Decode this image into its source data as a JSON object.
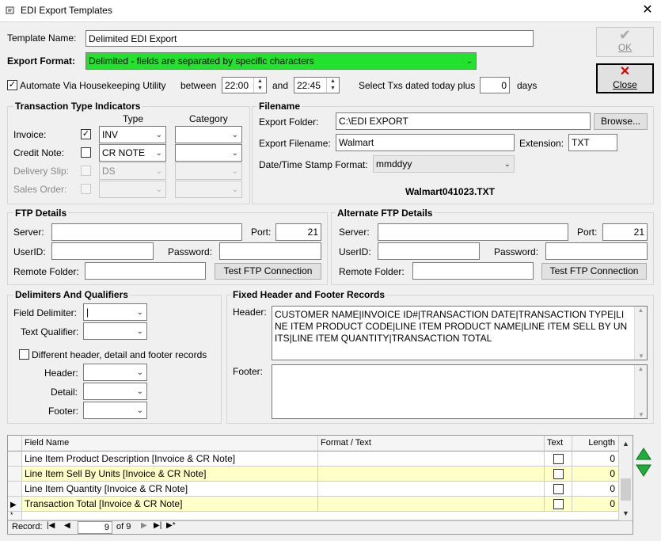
{
  "window": {
    "title": "EDI Export Templates",
    "close_glyph": "✕"
  },
  "buttons": {
    "ok": "OK",
    "close": "Close",
    "browse": "Browse...",
    "test_ftp": "Test FTP Connection",
    "test_ftp_alt": "Test FTP Connection"
  },
  "template": {
    "name_label": "Template Name:",
    "name_value": "Delimited EDI Export",
    "format_label": "Export Format:",
    "format_value": "Delimited - fields are separated by specific characters",
    "format_color": "#22e22d"
  },
  "automate": {
    "label": "Automate Via Housekeeping Utility",
    "between_label": "between",
    "start_time": "22:00",
    "and_label": "and",
    "end_time": "22:45",
    "select_txs_label": "Select Txs dated today plus",
    "days_value": "0",
    "days_label": "days"
  },
  "tti": {
    "title": "Transaction Type Indicators",
    "type_header": "Type",
    "category_header": "Category",
    "rows": [
      {
        "label": "Invoice:",
        "type": "INV"
      },
      {
        "label": "Credit Note:",
        "type": "CR NOTE"
      },
      {
        "label": "Delivery Slip:",
        "type": "DS"
      },
      {
        "label": "Sales Order:",
        "type": ""
      }
    ]
  },
  "filename": {
    "title": "Filename",
    "folder_label": "Export Folder:",
    "folder_value": "C:\\EDI EXPORT",
    "file_label": "Export Filename:",
    "file_value": "Walmart",
    "ext_label": "Extension:",
    "ext_value": "TXT",
    "stamp_label": "Date/Time Stamp Format:",
    "stamp_value": "mmddyy",
    "preview": "Walmart041023.TXT"
  },
  "ftp": {
    "title": "FTP Details",
    "server_label": "Server:",
    "port_label": "Port:",
    "port_value": "21",
    "userid_label": "UserID:",
    "password_label": "Password:",
    "remote_label": "Remote Folder:"
  },
  "alt_ftp": {
    "title": "Alternate FTP Details",
    "server_label": "Server:",
    "port_label": "Port:",
    "port_value": "21",
    "userid_label": "UserID:",
    "password_label": "Password:",
    "remote_label": "Remote Folder:"
  },
  "delims": {
    "title": "Delimiters And Qualifiers",
    "field_label": "Field Delimiter:",
    "field_value": "|",
    "text_label": "Text Qualifier:",
    "diff_label": "Different header, detail and footer records",
    "header_label": "Header:",
    "detail_label": "Detail:",
    "footer_label": "Footer:"
  },
  "records": {
    "title": "Fixed Header and Footer Records",
    "header_label": "Header:",
    "header_value": "CUSTOMER NAME|INVOICE ID#|TRANSACTION DATE|TRANSACTION TYPE|LINE ITEM PRODUCT CODE|LINE ITEM PRODUCT NAME|LINE ITEM SELL BY UNITS|LINE ITEM QUANTITY|TRANSACTION TOTAL",
    "footer_label": "Footer:"
  },
  "grid": {
    "headers": [
      "Field Name",
      "Format / Text",
      "Text",
      "Length"
    ],
    "rows": [
      {
        "field": "Line Item Product Description [Invoice & CR Note]",
        "format": "",
        "length": "0",
        "highlight": false
      },
      {
        "field": "Line Item Sell By Units [Invoice & CR Note]",
        "format": "",
        "length": "0",
        "highlight": true
      },
      {
        "field": "Line Item Quantity [Invoice & CR Note]",
        "format": "",
        "length": "0",
        "highlight": false
      },
      {
        "field": "Transaction Total [Invoice & CR Note]",
        "format": "",
        "length": "0",
        "highlight": true
      }
    ],
    "nav": {
      "record_label": "Record:",
      "current": "9",
      "of_label": "of 9"
    }
  }
}
